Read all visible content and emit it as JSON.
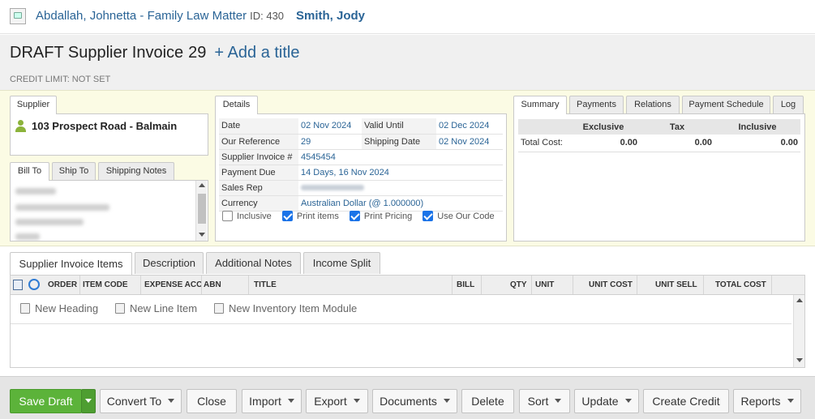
{
  "topbar": {
    "matter": "Abdallah, Johnetta - Family Law Matter",
    "matter_id": "ID: 430",
    "person": "Smith, Jody"
  },
  "header": {
    "title": "DRAFT Supplier Invoice",
    "number": "29",
    "add_title": "+ Add a title",
    "credit_limit": "CREDIT LIMIT: NOT SET"
  },
  "supplier": {
    "tab": "Supplier",
    "name": "103 Prospect Road - Balmain"
  },
  "address_tabs": [
    "Bill To",
    "Ship To",
    "Shipping Notes"
  ],
  "details": {
    "tab": "Details",
    "rows": [
      {
        "label": "Date",
        "value": "02 Nov 2024",
        "label2": "Valid Until",
        "value2": "02 Dec 2024"
      },
      {
        "label": "Our Reference",
        "value": "29",
        "label2": "Shipping Date",
        "value2": "02 Nov 2024"
      },
      {
        "label": "Supplier Invoice #",
        "value": "4545454"
      },
      {
        "label": "Payment Due",
        "value": "14 Days, 16 Nov 2024"
      },
      {
        "label": "Sales Rep",
        "value": ""
      },
      {
        "label": "Currency",
        "value": "Australian Dollar (@ 1.000000)"
      }
    ],
    "checkboxes": [
      {
        "label": "Inclusive",
        "checked": false
      },
      {
        "label": "Print items",
        "checked": true
      },
      {
        "label": "Print Pricing",
        "checked": true
      },
      {
        "label": "Use Our Code",
        "checked": true
      }
    ]
  },
  "summary": {
    "tabs": [
      "Summary",
      "Payments",
      "Relations",
      "Payment Schedule",
      "Log"
    ],
    "headers": [
      "Exclusive",
      "Tax",
      "Inclusive"
    ],
    "row_label": "Total Cost:",
    "values": [
      "0.00",
      "0.00",
      "0.00"
    ]
  },
  "items": {
    "tabs": [
      "Supplier Invoice Items",
      "Description",
      "Additional Notes",
      "Income Split"
    ],
    "columns": [
      "ORDER",
      "ITEM CODE",
      "EXPENSE ACC",
      "ABN",
      "TITLE",
      "BILL",
      "QTY",
      "UNIT",
      "UNIT COST",
      "UNIT SELL",
      "TOTAL COST"
    ],
    "actions": [
      "New Heading",
      "New Line Item",
      "New Inventory Item Module"
    ]
  },
  "footer": {
    "buttons": [
      "Save Draft",
      "Convert To",
      "Close",
      "Import",
      "Export",
      "Documents",
      "Delete",
      "Sort",
      "Update",
      "Create Credit",
      "Reports"
    ]
  },
  "colors": {
    "link": "#2a6496",
    "save": "#5cb33a",
    "panel_bg": "#fbfbe4"
  }
}
